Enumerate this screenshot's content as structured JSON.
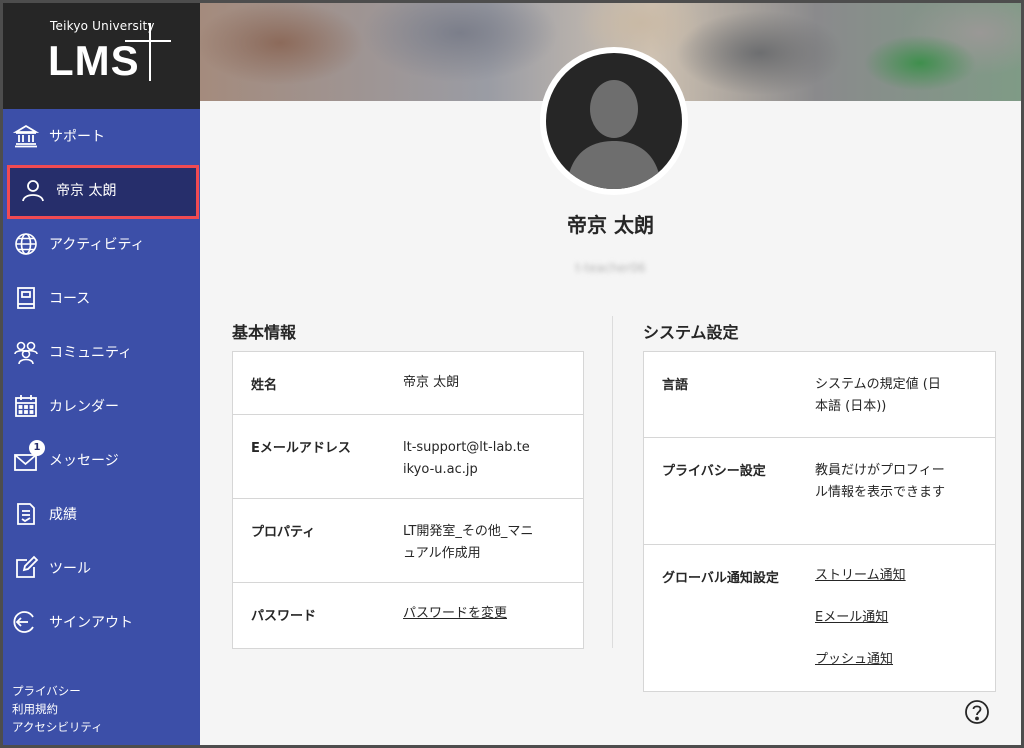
{
  "logo": {
    "small": "Teikyo University",
    "big": "LMS"
  },
  "nav": [
    {
      "id": "support",
      "label": "サポート",
      "icon": "bank-icon"
    },
    {
      "id": "profile",
      "label": "帝京 太朗",
      "icon": "user-icon",
      "active": true
    },
    {
      "id": "activity",
      "label": "アクティビティ",
      "icon": "globe-icon"
    },
    {
      "id": "courses",
      "label": "コース",
      "icon": "book-icon"
    },
    {
      "id": "community",
      "label": "コミュニティ",
      "icon": "people-icon"
    },
    {
      "id": "calendar",
      "label": "カレンダー",
      "icon": "calendar-icon"
    },
    {
      "id": "messages",
      "label": "メッセージ",
      "icon": "mail-icon",
      "badge": "1"
    },
    {
      "id": "grades",
      "label": "成績",
      "icon": "grades-icon"
    },
    {
      "id": "tools",
      "label": "ツール",
      "icon": "edit-icon"
    },
    {
      "id": "signout",
      "label": "サインアウト",
      "icon": "signout-icon"
    }
  ],
  "footer_links": [
    "プライバシー",
    "利用規約",
    "アクセシビリティ"
  ],
  "profile": {
    "name": "帝京 太朗",
    "user_id": "t-teacher06"
  },
  "basic": {
    "title": "基本情報",
    "rows": [
      {
        "key": "姓名",
        "value": "帝京 太朗"
      },
      {
        "key": "Eメールアドレス",
        "value": "lt-support@lt-lab.teikyo-u.ac.jp"
      },
      {
        "key": "プロパティ",
        "value": "LT開発室_その他_マニュアル作成用"
      },
      {
        "key": "パスワード",
        "value": "パスワードを変更"
      }
    ]
  },
  "system": {
    "title": "システム設定",
    "rows": [
      {
        "key": "言語",
        "value": "システムの規定値 (日本語 (日本))"
      },
      {
        "key": "プライバシー設定",
        "value": "教員だけがプロフィール情報を表示できます"
      },
      {
        "key": "グローバル通知設定",
        "links": [
          "ストリーム通知",
          "Eメール通知",
          "プッシュ通知"
        ]
      }
    ]
  },
  "colors": {
    "sidebar": "#3c4fa8",
    "active": "#262e6b",
    "highlight": "#f04a52",
    "link": "#2f6fb3"
  }
}
